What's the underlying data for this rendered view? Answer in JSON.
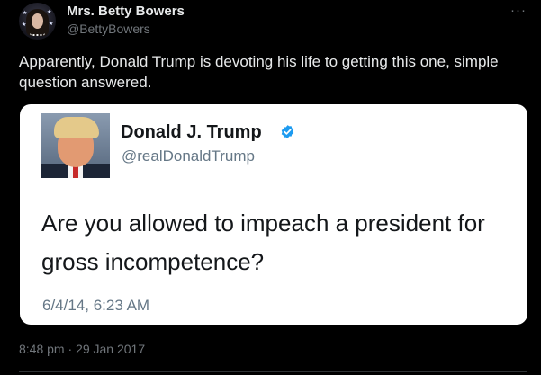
{
  "post": {
    "author": {
      "display_name": "Mrs. Betty Bowers",
      "handle": "@BettyBowers",
      "avatar_icon": "avatar-woman-portrait"
    },
    "more_icon": "more-horizontal-icon",
    "more_label": "···",
    "text": "Apparently, Donald Trump is devoting his life to getting this one, simple question answered.",
    "time": "8:48 pm",
    "separator": "·",
    "date": "29 Jan 2017"
  },
  "embedded": {
    "display_name": "Donald J. Trump",
    "handle": "@realDonaldTrump",
    "verified_icon": "verified-badge-icon",
    "text": "Are you allowed to impeach a president for gross incompetence?",
    "timestamp": "6/4/14, 6:23 AM"
  },
  "colors": {
    "background": "#000000",
    "primary_text": "#e7e9ea",
    "secondary_text": "#71767b",
    "card_background": "#ffffff",
    "card_text": "#14171a",
    "card_secondary_text": "#657786",
    "verified_blue": "#1d9bf0"
  }
}
